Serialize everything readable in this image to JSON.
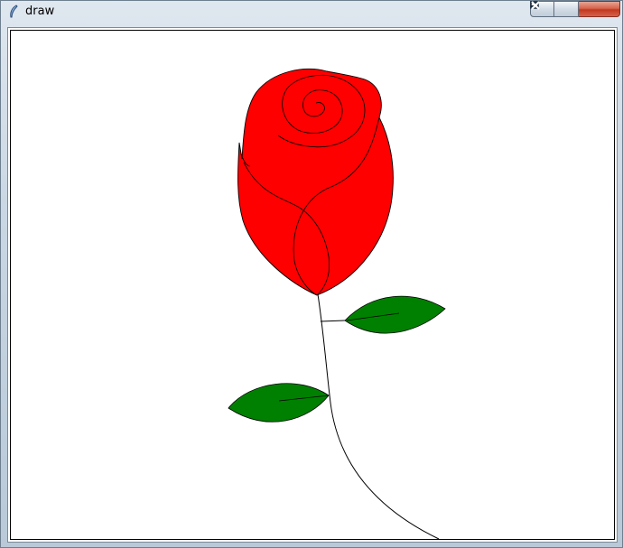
{
  "window": {
    "title": "draw",
    "icon": "feather-icon",
    "controls": [
      "minimize-icon",
      "maximize-icon",
      "close-icon"
    ]
  },
  "drawing": {
    "subject": "rose",
    "colors": {
      "petal": "#ff0000",
      "leaf": "#008000",
      "outline": "#000000",
      "background": "#ffffff"
    }
  }
}
